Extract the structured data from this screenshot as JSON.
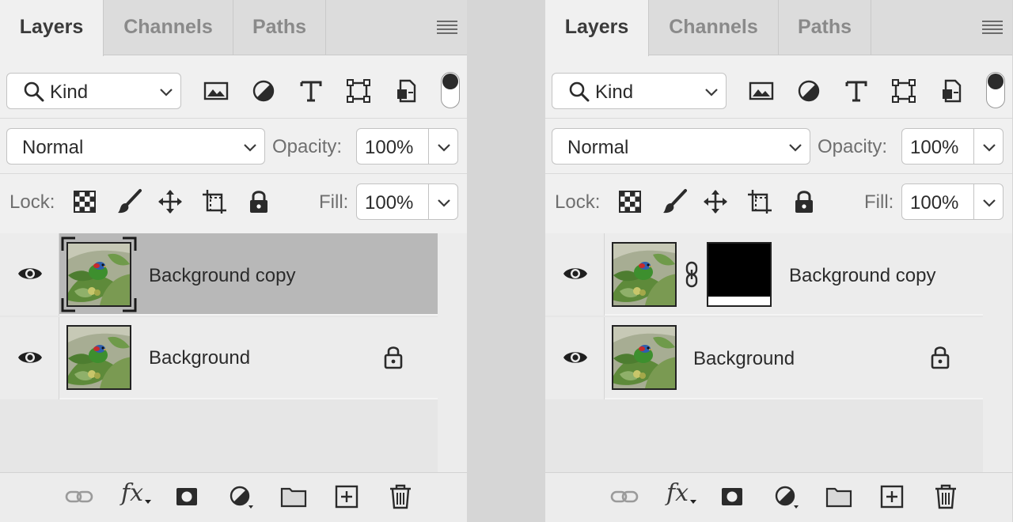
{
  "panels": [
    {
      "id": "left",
      "tabs": [
        "Layers",
        "Channels",
        "Paths"
      ],
      "kind_label": "Kind",
      "blend_mode": "Normal",
      "opacity_label": "Opacity:",
      "opacity_value": "100%",
      "lock_label": "Lock:",
      "fill_label": "Fill:",
      "fill_value": "100%",
      "layers": [
        {
          "name": "Background copy",
          "selected": true,
          "has_mask": false,
          "locked": false
        },
        {
          "name": "Background",
          "selected": false,
          "has_mask": false,
          "locked": true
        }
      ]
    },
    {
      "id": "right",
      "tabs": [
        "Layers",
        "Channels",
        "Paths"
      ],
      "kind_label": "Kind",
      "blend_mode": "Normal",
      "opacity_label": "Opacity:",
      "opacity_value": "100%",
      "lock_label": "Lock:",
      "fill_label": "Fill:",
      "fill_value": "100%",
      "layers": [
        {
          "name": "Background copy",
          "selected": false,
          "has_mask": true,
          "locked": false
        },
        {
          "name": "Background",
          "selected": false,
          "has_mask": false,
          "locked": true
        }
      ]
    }
  ],
  "icons": {
    "filter": [
      "image-filter-icon",
      "adjustment-filter-icon",
      "type-filter-icon",
      "shape-filter-icon",
      "smart-object-filter-icon"
    ],
    "lock": [
      "lock-transparent-pixels-icon",
      "lock-image-pixels-icon",
      "lock-position-icon",
      "lock-artboard-icon",
      "lock-all-icon"
    ],
    "bottom": [
      "link-layers-icon",
      "fx-icon",
      "add-mask-icon",
      "new-adjustment-icon",
      "new-group-icon",
      "new-layer-icon",
      "delete-layer-icon"
    ]
  },
  "bottom_bar": {
    "fx_label": "fx"
  },
  "colors": {
    "panel_bg": "#f0f0f0",
    "tab_bar": "#dcdcdc",
    "selected_row": "#b8b8b8",
    "row_bg": "#ececec",
    "divider_gap": "#d6d6d6"
  }
}
